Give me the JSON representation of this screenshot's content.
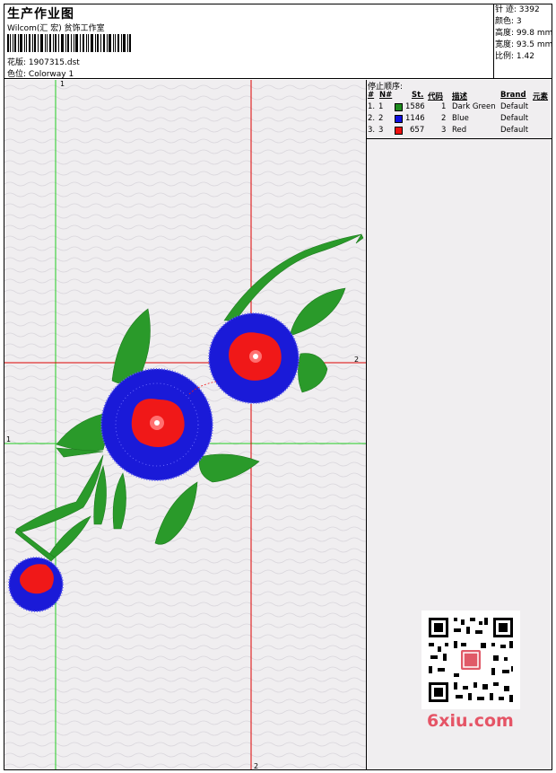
{
  "header": {
    "title": "生产作业图",
    "studio": "Wilcom(汇 宏) 贫饰工作室",
    "design_label": "花版:",
    "design_value": "1907315.dst",
    "colorway_label": "色位:",
    "colorway_value": "Colorway 1"
  },
  "stats": {
    "stitches_label": "针 迹:",
    "stitches_value": "3392",
    "colors_label": "颜色:",
    "colors_value": "3",
    "height_label": "高度:",
    "height_value": "99.8 mm",
    "width_label": "宽度:",
    "width_value": "93.5 mm",
    "ratio_label": "比例:",
    "ratio_value": "1.42"
  },
  "stop_sequence": {
    "title": "停止顺序:",
    "columns": [
      "#",
      "N#",
      "St.",
      "代码",
      "描述",
      "Brand",
      "元素"
    ],
    "rows": [
      {
        "idx": "1.",
        "num": "1",
        "color": "#1e8c1e",
        "st": "1586",
        "code": "1",
        "desc": "Dark Green",
        "brand": "Default"
      },
      {
        "idx": "2.",
        "num": "2",
        "color": "#1010e0",
        "st": "1146",
        "code": "2",
        "desc": "Blue",
        "brand": "Default"
      },
      {
        "idx": "3.",
        "num": "3",
        "color": "#ee1010",
        "st": "657",
        "code": "3",
        "desc": "Red",
        "brand": "Default"
      }
    ]
  },
  "guides": {
    "green_vertical_label": "1",
    "green_horizontal_label": "1",
    "red_horizontal_label": "2",
    "red_vertical_label": "2"
  },
  "colors": {
    "green": "#2a9a2a",
    "blue": "#1a1ad8",
    "red": "#f01818",
    "guide_green": "#22cc22",
    "guide_red": "#dd0000",
    "watermark": "#e55466"
  },
  "watermark": {
    "text": "6xiu.com",
    "qr_icon": "qr-code-icon"
  }
}
